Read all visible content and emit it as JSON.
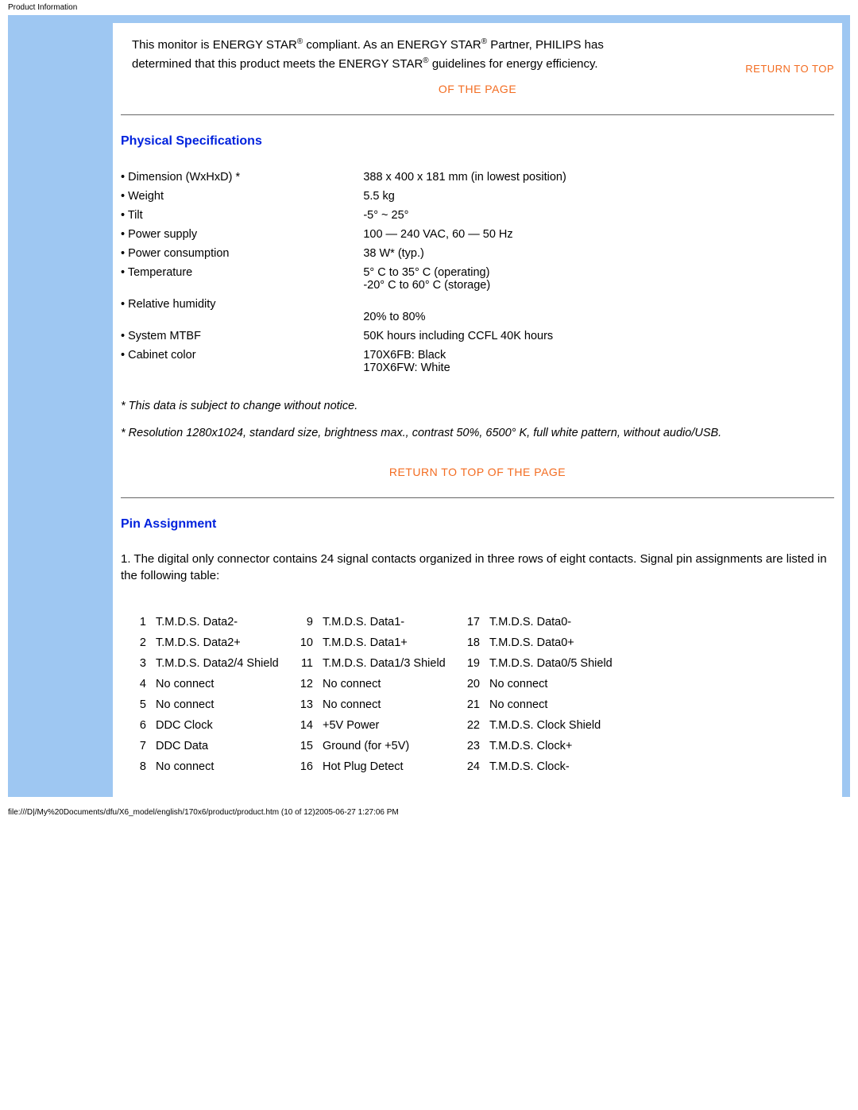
{
  "header_text": "Product Information",
  "intro": {
    "line1a": "This monitor is ENERGY STAR",
    "line1b": " compliant. As an ENERGY STAR",
    "line1c": " Partner, PHILIPS has",
    "line2a": "determined that this product meets the ENERGY STAR",
    "line2b": " guidelines for energy efficiency."
  },
  "links": {
    "return_top_1": "RETURN TO TOP",
    "of_the_page_1": "OF THE PAGE",
    "return_top_2": "RETURN TO TOP OF THE PAGE"
  },
  "section_physical_title": "Physical Specifications",
  "specs": [
    {
      "label": "• Dimension (WxHxD) *",
      "value": "388 x 400 x 181 mm (in lowest position)"
    },
    {
      "label": "• Weight",
      "value": "5.5 kg"
    },
    {
      "label": "• Tilt",
      "value": "-5° ~ 25°"
    },
    {
      "label": "• Power supply",
      "value": "100 — 240 VAC, 60 — 50 Hz"
    },
    {
      "label": "• Power consumption",
      "value": "38 W* (typ.)"
    },
    {
      "label": "• Temperature",
      "value": "5° C to 35° C (operating)\n-20° C to 60° C (storage)"
    },
    {
      "label": "• Relative humidity",
      "value": "\n20% to 80%"
    },
    {
      "label": "• System MTBF",
      "value": "50K hours including CCFL 40K hours"
    },
    {
      "label": "• Cabinet color",
      "value": "170X6FB: Black\n170X6FW: White"
    }
  ],
  "footnote1": "* This data is subject to change without notice.",
  "footnote2": "* Resolution 1280x1024, standard size, brightness max., contrast 50%, 6500° K, full white pattern, without audio/USB.",
  "section_pin_title": "Pin Assignment",
  "pin_intro": "1. The digital only connector contains 24 signal contacts organized in three rows of eight contacts. Signal pin assignments are listed in the following table:",
  "pins": [
    {
      "n": "1",
      "s": "T.M.D.S. Data2-"
    },
    {
      "n": "2",
      "s": "T.M.D.S. Data2+"
    },
    {
      "n": "3",
      "s": "T.M.D.S. Data2/4 Shield"
    },
    {
      "n": "4",
      "s": "No connect"
    },
    {
      "n": "5",
      "s": "No connect"
    },
    {
      "n": "6",
      "s": "DDC Clock"
    },
    {
      "n": "7",
      "s": "DDC Data"
    },
    {
      "n": "8",
      "s": "No connect"
    },
    {
      "n": "9",
      "s": "T.M.D.S. Data1-"
    },
    {
      "n": "10",
      "s": "T.M.D.S. Data1+"
    },
    {
      "n": "11",
      "s": "T.M.D.S. Data1/3 Shield"
    },
    {
      "n": "12",
      "s": "No connect"
    },
    {
      "n": "13",
      "s": "No connect"
    },
    {
      "n": "14",
      "s": "+5V Power"
    },
    {
      "n": "15",
      "s": "Ground (for +5V)"
    },
    {
      "n": "16",
      "s": "Hot Plug Detect"
    },
    {
      "n": "17",
      "s": "T.M.D.S. Data0-"
    },
    {
      "n": "18",
      "s": "T.M.D.S. Data0+"
    },
    {
      "n": "19",
      "s": "T.M.D.S. Data0/5 Shield"
    },
    {
      "n": "20",
      "s": "No connect"
    },
    {
      "n": "21",
      "s": "No connect"
    },
    {
      "n": "22",
      "s": "T.M.D.S. Clock Shield"
    },
    {
      "n": "23",
      "s": "T.M.D.S. Clock+"
    },
    {
      "n": "24",
      "s": "T.M.D.S. Clock-"
    }
  ],
  "footer_path": "file:///D|/My%20Documents/dfu/X6_model/english/170x6/product/product.htm (10 of 12)2005-06-27 1:27:06 PM"
}
